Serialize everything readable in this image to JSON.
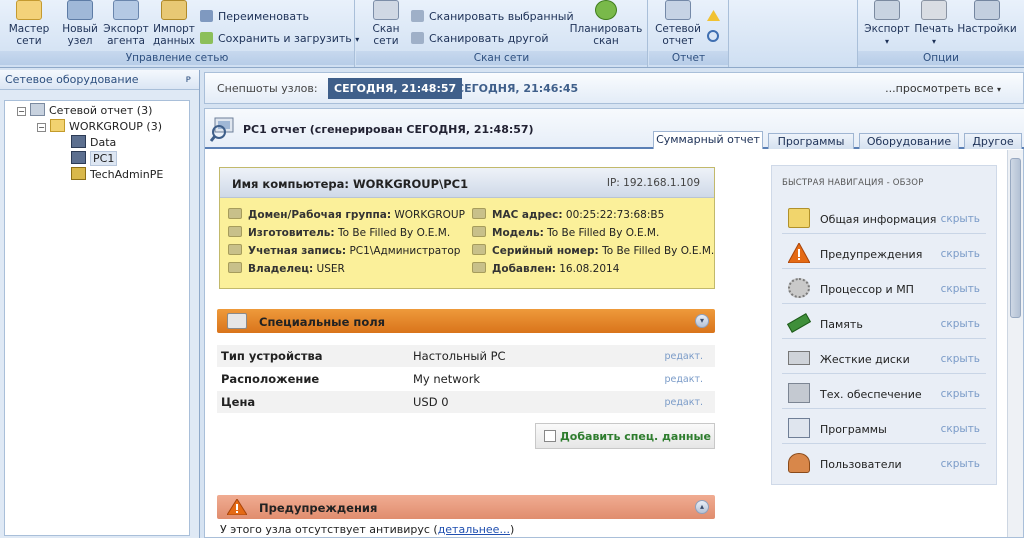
{
  "ribbon": {
    "groups": [
      {
        "title": "Управление сетью",
        "buttons": [
          "Мастер\nсети",
          "Новый\nузел",
          "Экспорт\nагента",
          "Импорт\nданных"
        ],
        "small": [
          "Переименовать",
          "Сохранить и загрузить"
        ]
      },
      {
        "title": "Скан сети",
        "buttons": [
          "Скан\nсети",
          "Планировать\nскан"
        ],
        "small": [
          "Сканировать выбранный",
          "Сканировать другой"
        ]
      },
      {
        "title": "Отчет",
        "buttons": [
          "Сетевой\nотчет"
        ]
      },
      {
        "title": "Опции",
        "buttons": [
          "Экспорт",
          "Печать",
          "Настройки"
        ]
      }
    ]
  },
  "left_panel": {
    "title": "Сетевое оборудование",
    "pin": "ᴘ",
    "tree": [
      {
        "label": "Сетевой отчет (3)",
        "exp": "−"
      },
      {
        "label": "WORKGROUP (3)",
        "exp": "−"
      },
      {
        "label": "Data"
      },
      {
        "label": "PC1"
      },
      {
        "label": "TechAdminPE"
      }
    ]
  },
  "snapshots": {
    "label": "Снепшоты узлов:",
    "active": "СЕГОДНЯ, 21:48:57",
    "other": "СЕГОДНЯ, 21:46:45",
    "more": "...просмотреть все"
  },
  "report": {
    "title": "PC1 отчет (сгенерирован СЕГОДНЯ, 21:48:57)",
    "tabs": [
      "Суммарный отчет",
      "Программы",
      "Оборудование",
      "Другое"
    ]
  },
  "computer": {
    "name": "Имя компьютера: WORKGROUP\\PC1",
    "ip": "IP: 192.168.1.109",
    "left_fields": [
      {
        "label": "Домен/Рабочая группа:",
        "value": "WORKGROUP"
      },
      {
        "label": "Изготовитель:",
        "value": "To Be Filled By O.E.M."
      },
      {
        "label": "Учетная запись:",
        "value": "PC1\\Администратор"
      },
      {
        "label": "Владелец:",
        "value": "USER"
      }
    ],
    "right_fields": [
      {
        "label": "MAC адрес:",
        "value": "00:25:22:73:68:B5"
      },
      {
        "label": "Модель:",
        "value": "To Be Filled By O.E.M."
      },
      {
        "label": "Серийный номер:",
        "value": "To Be Filled By O.E.M."
      },
      {
        "label": "Добавлен:",
        "value": "16.08.2014"
      }
    ]
  },
  "special": {
    "title": "Специальные поля",
    "rows": [
      {
        "label": "Тип устройства",
        "value": "Настольный PC",
        "edit": "редакт."
      },
      {
        "label": "Расположение",
        "value": "My network",
        "edit": "редакт."
      },
      {
        "label": "Цена",
        "value": "USD 0",
        "edit": "редакт."
      }
    ],
    "add_button": "Добавить спец. данные"
  },
  "warnings": {
    "title": "Предупреждения",
    "text": "У этого узла отсутствует антивирус (",
    "link": "детальнее...",
    "tail": ")"
  },
  "quick_nav": {
    "title": "БЫСТРАЯ НАВИГАЦИЯ - ОБЗОР",
    "items": [
      {
        "label": "Общая информация",
        "action": "скрыть"
      },
      {
        "label": "Предупреждения",
        "action": "скрыть"
      },
      {
        "label": "Процессор и МП",
        "action": "скрыть"
      },
      {
        "label": "Память",
        "action": "скрыть"
      },
      {
        "label": "Жесткие диски",
        "action": "скрыть"
      },
      {
        "label": "Тех. обеспечение",
        "action": "скрыть"
      },
      {
        "label": "Программы",
        "action": "скрыть"
      },
      {
        "label": "Пользователи",
        "action": "скрыть"
      }
    ]
  },
  "colors": {
    "accent_blue": "#3f5f8a",
    "section_orange": "#e38324",
    "section_warning": "#e89a7c",
    "card_yellow": "#fbf09a"
  }
}
